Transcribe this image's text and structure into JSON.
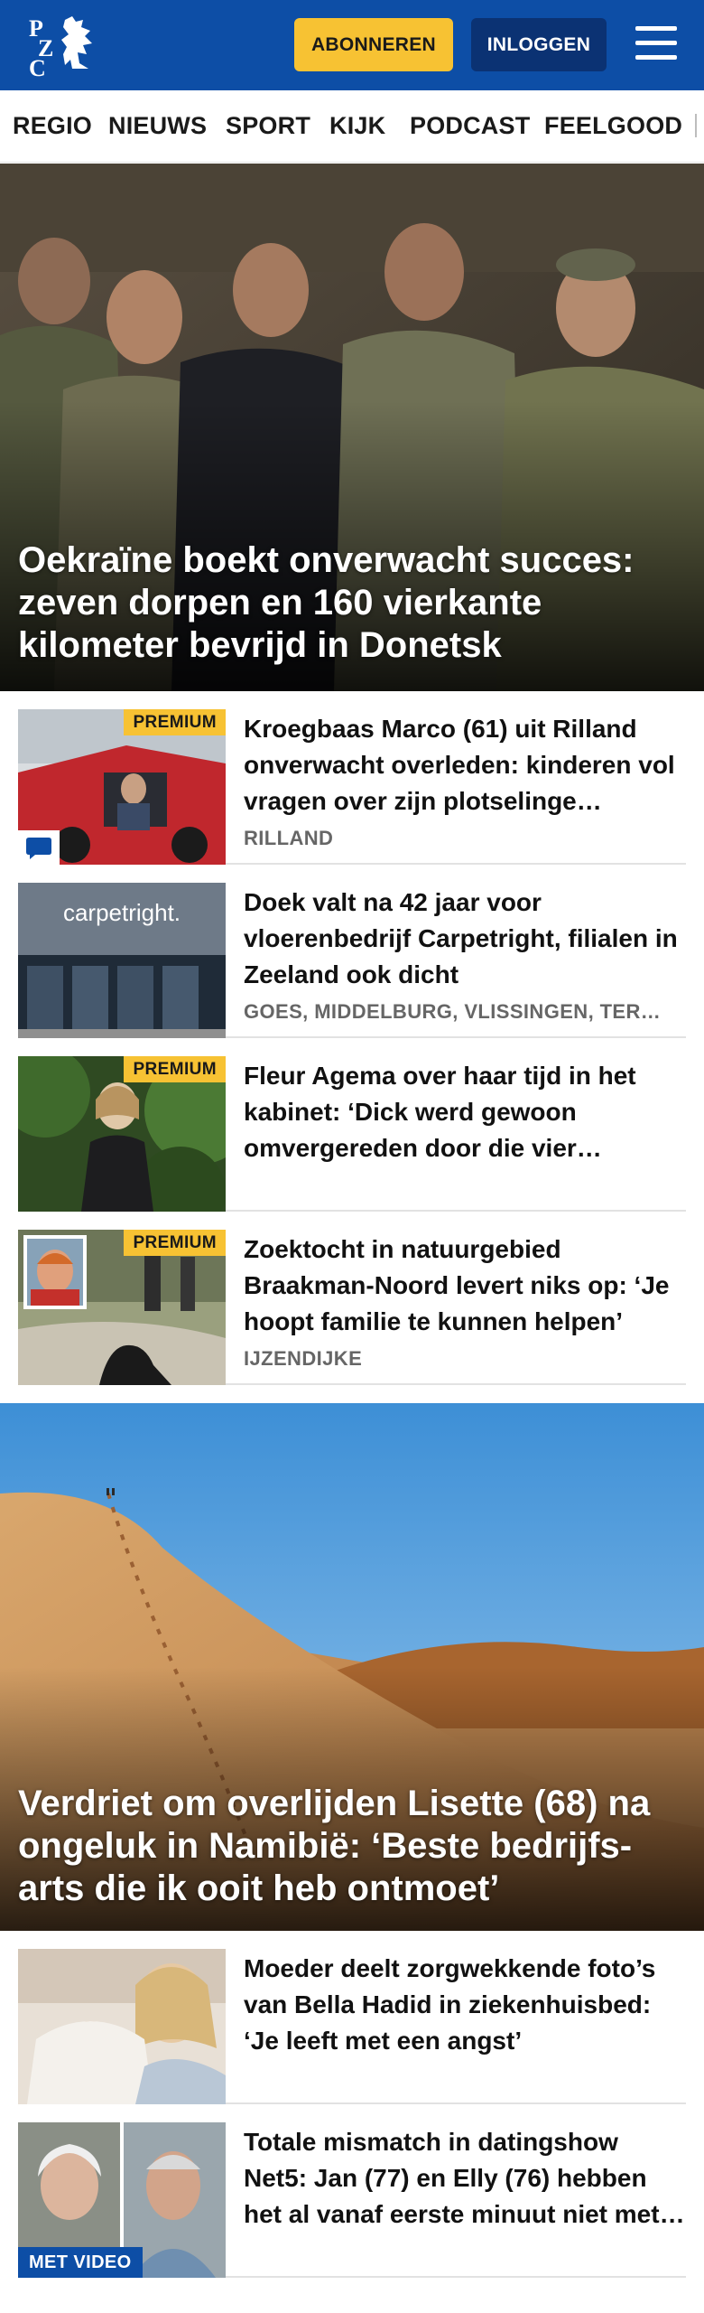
{
  "header": {
    "logo_icon": "pzc-logo-icon",
    "logo_text": "PZC",
    "subscribe_label": "ABONNEREN",
    "login_label": "INLOGGEN",
    "menu_icon": "hamburger-menu-icon",
    "colors": {
      "brand_blue": "#0d4ea6",
      "accent_yellow": "#f7c233",
      "login_blue": "#0b3273"
    }
  },
  "nav": {
    "items": [
      "REGIO",
      "NIEUWS",
      "SPORT",
      "KIJK",
      "PODCAST",
      "FEELGOOD"
    ]
  },
  "hero1": {
    "title": "Oekraïne boekt onverwacht succes: zeven dorpen en 160 vierkante kilometer bevrijd in Donetsk"
  },
  "articles1": [
    {
      "headline": "Kroegbaas Marco (61) uit Rilland onverwacht overleden: kinderen vol vragen over zijn plotselinge overlijden",
      "location": "RILLAND",
      "badge": "PREMIUM",
      "comment_icon": "comment-icon"
    },
    {
      "headline": "Doek valt na 42 jaar voor vloerenbedrijf Carpetright, filialen in Zeeland ook dicht",
      "location": "GOES, MIDDELBURG, VLISSINGEN, TERNEUZEN",
      "store_sign": "carpetright."
    },
    {
      "headline": "Fleur Agema over haar tijd in het kabinet: ‘Dick werd gewoon omvergereden door die vier mannen’",
      "badge": "PREMIUM"
    },
    {
      "headline": "Zoektocht in natuurgebied Braakman-Noord levert niks op: ‘Je hoopt familie te kunnen helpen’",
      "location": "IJZENDIJKE",
      "badge": "PREMIUM"
    }
  ],
  "hero2": {
    "title": "Verdriet om overlijden Lisette (68) na ongeluk in Namibië: ‘Beste bedrijfs-arts die ik ooit heb ontmoet’"
  },
  "articles2": [
    {
      "headline": "Moeder deelt zorgwekkende foto’s van Bella Hadid in ziekenhuisbed: ‘Je leeft met een angst’"
    },
    {
      "headline": "Totale mismatch in datingshow Net5: Jan (77) en Elly (76) hebben het al vanaf eerste minuut niet met elkaar",
      "badge": "MET VIDEO"
    }
  ]
}
